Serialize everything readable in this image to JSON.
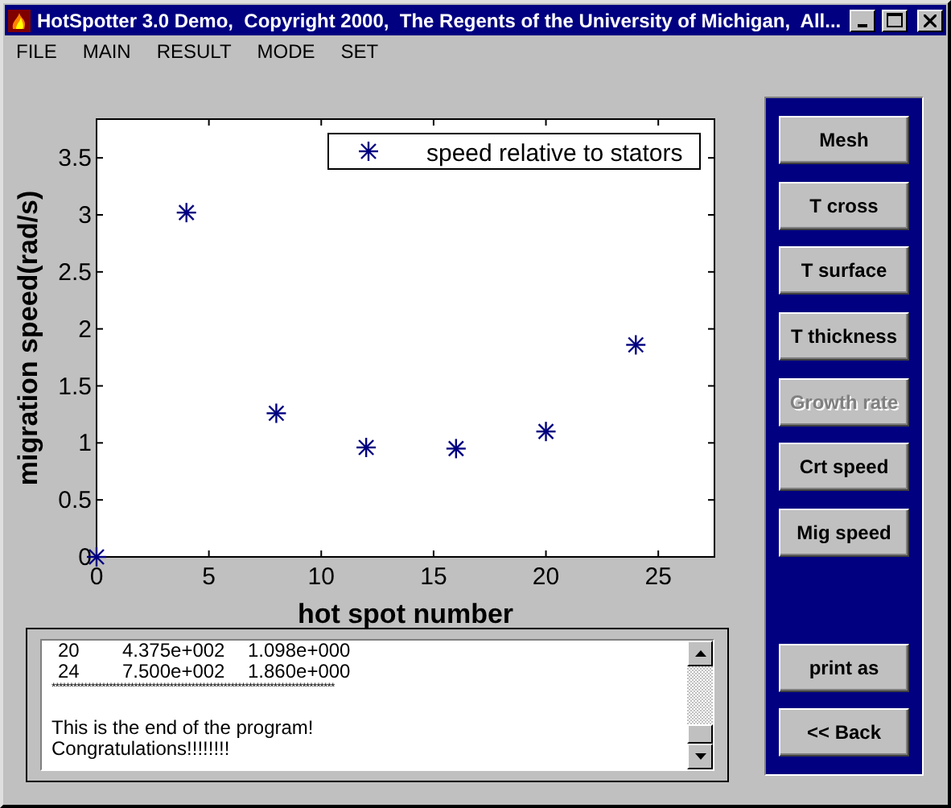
{
  "window": {
    "title": "HotSpotter 3.0 Demo,  Copyright 2000,  The Regents of the University of Michigan,  All..."
  },
  "menu": [
    "FILE",
    "MAIN",
    "RESULT",
    "MODE",
    "SET"
  ],
  "chart": {
    "chart_data": {
      "type": "scatter",
      "xlabel": "hot spot number",
      "ylabel": "migration speed(rad/s)",
      "xlim": [
        0,
        27.5
      ],
      "ylim": [
        0,
        3.84
      ],
      "xticks": [
        0,
        5,
        10,
        15,
        20,
        25
      ],
      "yticks": [
        0,
        0.5,
        1,
        1.5,
        2,
        2.5,
        3,
        3.5
      ],
      "series": [
        {
          "name": "speed relative to stators",
          "color": "#000080",
          "x": [
            0,
            4,
            8,
            12,
            16,
            20,
            24
          ],
          "values": [
            0,
            3.02,
            1.26,
            0.96,
            0.95,
            1.1,
            1.86
          ]
        }
      ]
    }
  },
  "console": {
    "lines": [
      {
        "kind": "row",
        "cells": [
          "20",
          "4.375e+002",
          "1.098e+000"
        ]
      },
      {
        "kind": "row",
        "cells": [
          "24",
          "7.500e+002",
          "1.860e+000"
        ]
      },
      {
        "kind": "rule",
        "text": "*******************************************************************************"
      },
      {
        "kind": "gap"
      },
      {
        "kind": "text",
        "text": "This is the end of the program!"
      },
      {
        "kind": "text",
        "text": "Congratulations!!!!!!!!"
      }
    ]
  },
  "buttons": [
    {
      "label": "Mesh",
      "disabled": false
    },
    {
      "label": "T cross",
      "disabled": false
    },
    {
      "label": "T surface",
      "disabled": false
    },
    {
      "label": "T thickness",
      "disabled": false
    },
    {
      "label": "Growth rate",
      "disabled": true
    },
    {
      "label": "Crt speed",
      "disabled": false
    },
    {
      "label": "Mig speed",
      "disabled": false
    }
  ],
  "bottom_buttons": [
    {
      "label": "print as",
      "disabled": false
    },
    {
      "label": "<< Back",
      "disabled": false
    }
  ]
}
